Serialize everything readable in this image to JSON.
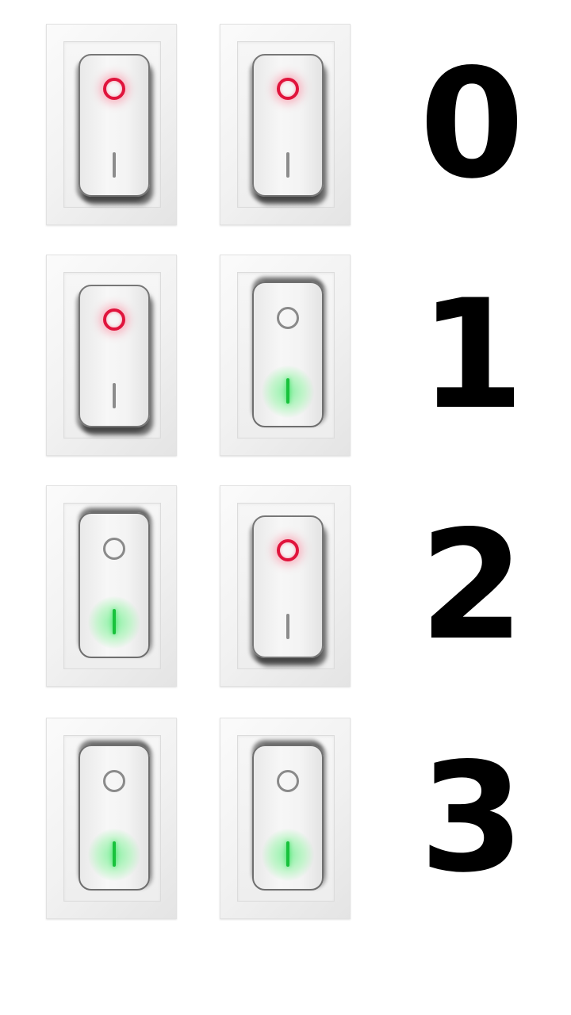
{
  "rows": [
    {
      "label": "0",
      "switches": [
        "off",
        "off"
      ]
    },
    {
      "label": "1",
      "switches": [
        "off",
        "on"
      ]
    },
    {
      "label": "2",
      "switches": [
        "on",
        "off"
      ]
    },
    {
      "label": "3",
      "switches": [
        "on",
        "on"
      ]
    }
  ],
  "colors": {
    "off_indicator": "#e0143c",
    "on_indicator": "#18c23c",
    "label": "#000000",
    "background": "#ffffff"
  }
}
